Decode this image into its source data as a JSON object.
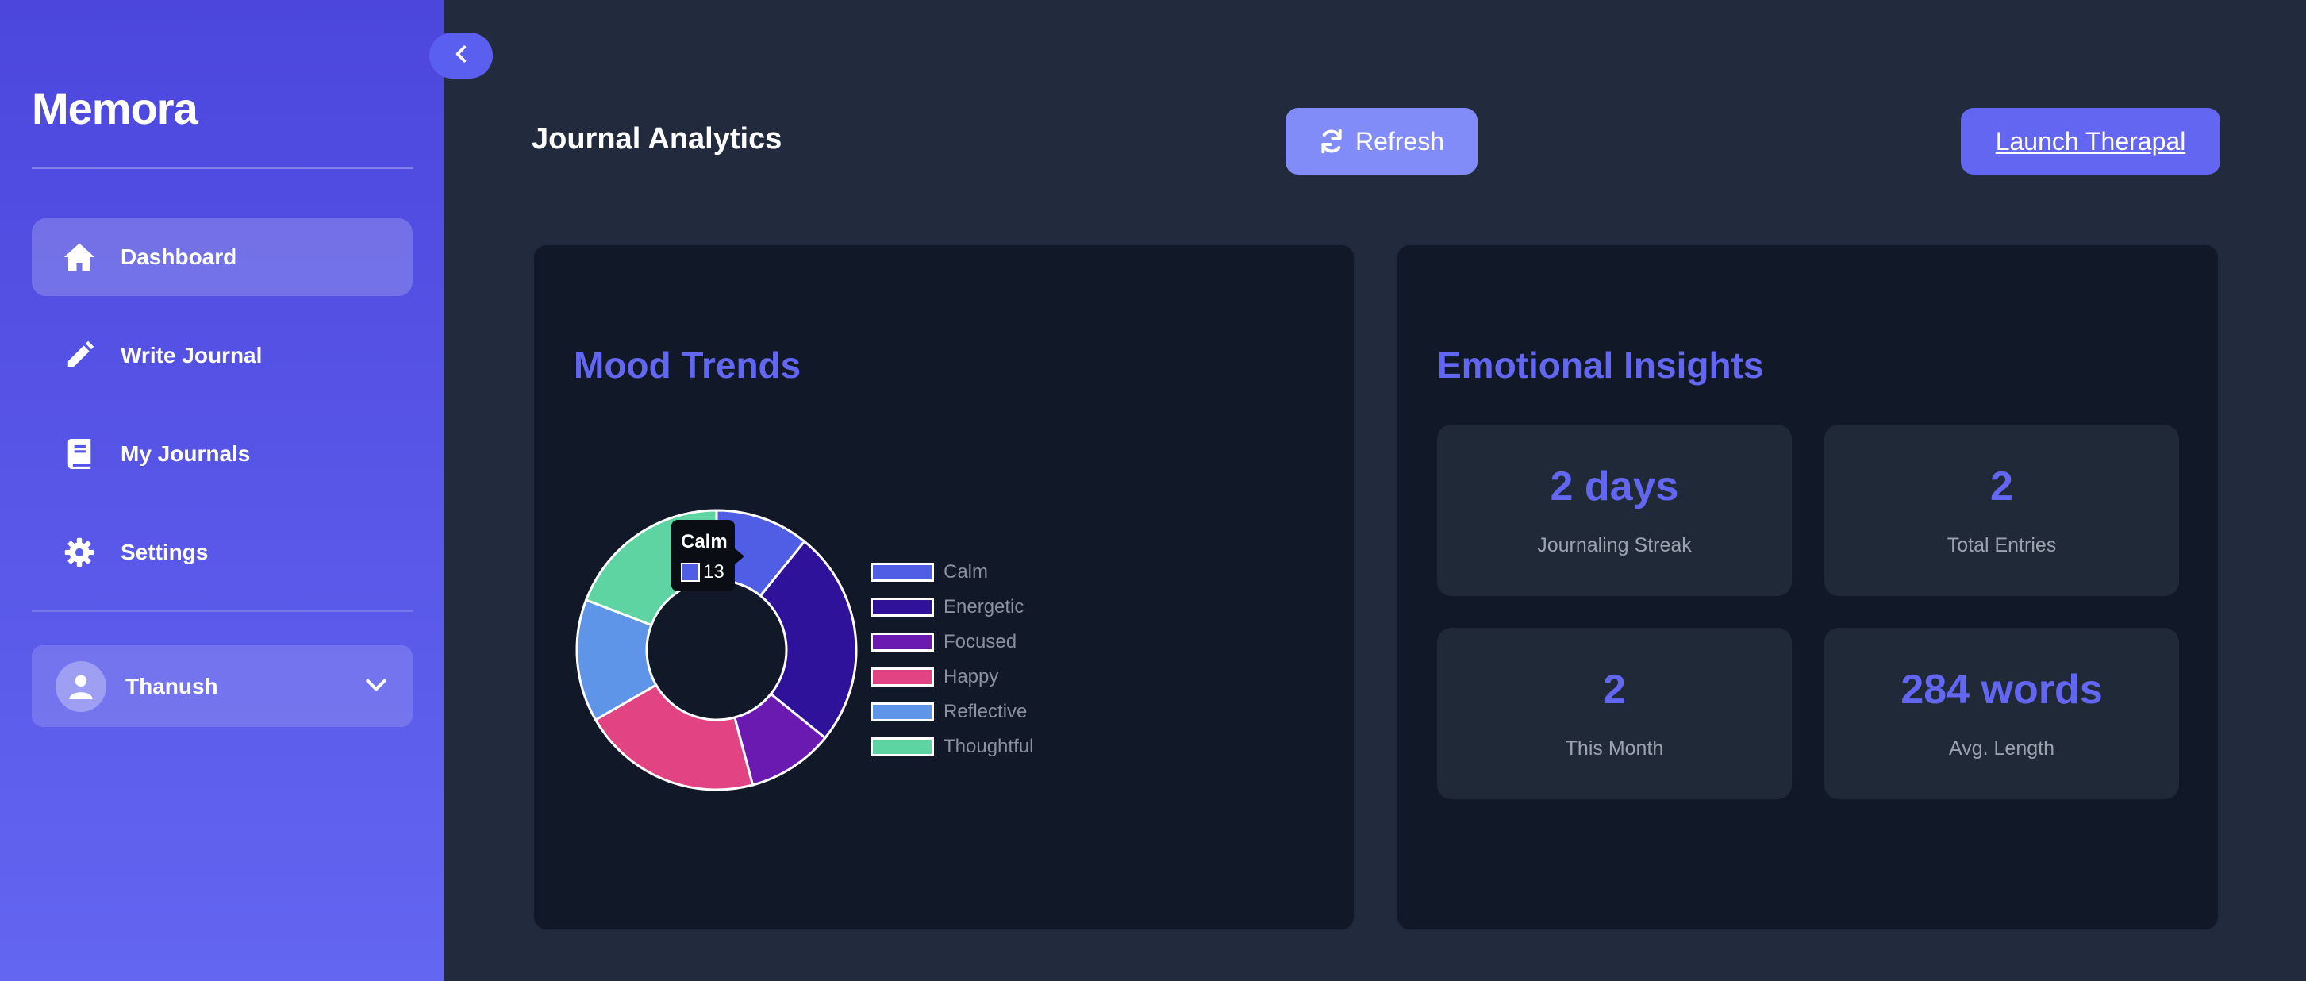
{
  "app": {
    "brand": "Memora"
  },
  "sidebar": {
    "items": [
      {
        "label": "Dashboard",
        "icon": "home-icon",
        "active": true
      },
      {
        "label": "Write Journal",
        "icon": "pencil-icon",
        "active": false
      },
      {
        "label": "My Journals",
        "icon": "book-icon",
        "active": false
      },
      {
        "label": "Settings",
        "icon": "gear-icon",
        "active": false
      }
    ],
    "user": {
      "name": "Thanush"
    }
  },
  "header": {
    "title": "Journal Analytics",
    "refresh_label": "Refresh",
    "launch_label": "Launch Therapal"
  },
  "mood": {
    "title": "Mood Trends",
    "tooltip": {
      "label": "Calm",
      "value": "13"
    }
  },
  "chart_data": {
    "type": "pie",
    "categories": [
      "Calm",
      "Energetic",
      "Focused",
      "Happy",
      "Reflective",
      "Thoughtful"
    ],
    "values": [
      13,
      30,
      12,
      25,
      17,
      23
    ],
    "colors": [
      "#4f5ee5",
      "#2e1299",
      "#6a1ab0",
      "#e24383",
      "#5f95e8",
      "#5dd4a2"
    ],
    "title": "",
    "legend": "right"
  },
  "insights": {
    "title": "Emotional Insights",
    "stats": [
      {
        "value": "2 days",
        "label": "Journaling Streak"
      },
      {
        "value": "2",
        "label": "Total Entries"
      },
      {
        "value": "2",
        "label": "This Month"
      },
      {
        "value": "284 words",
        "label": "Avg. Length"
      }
    ]
  },
  "colors": {
    "accent": "#6366f1",
    "background": "#222b3d",
    "card": "#111827"
  }
}
